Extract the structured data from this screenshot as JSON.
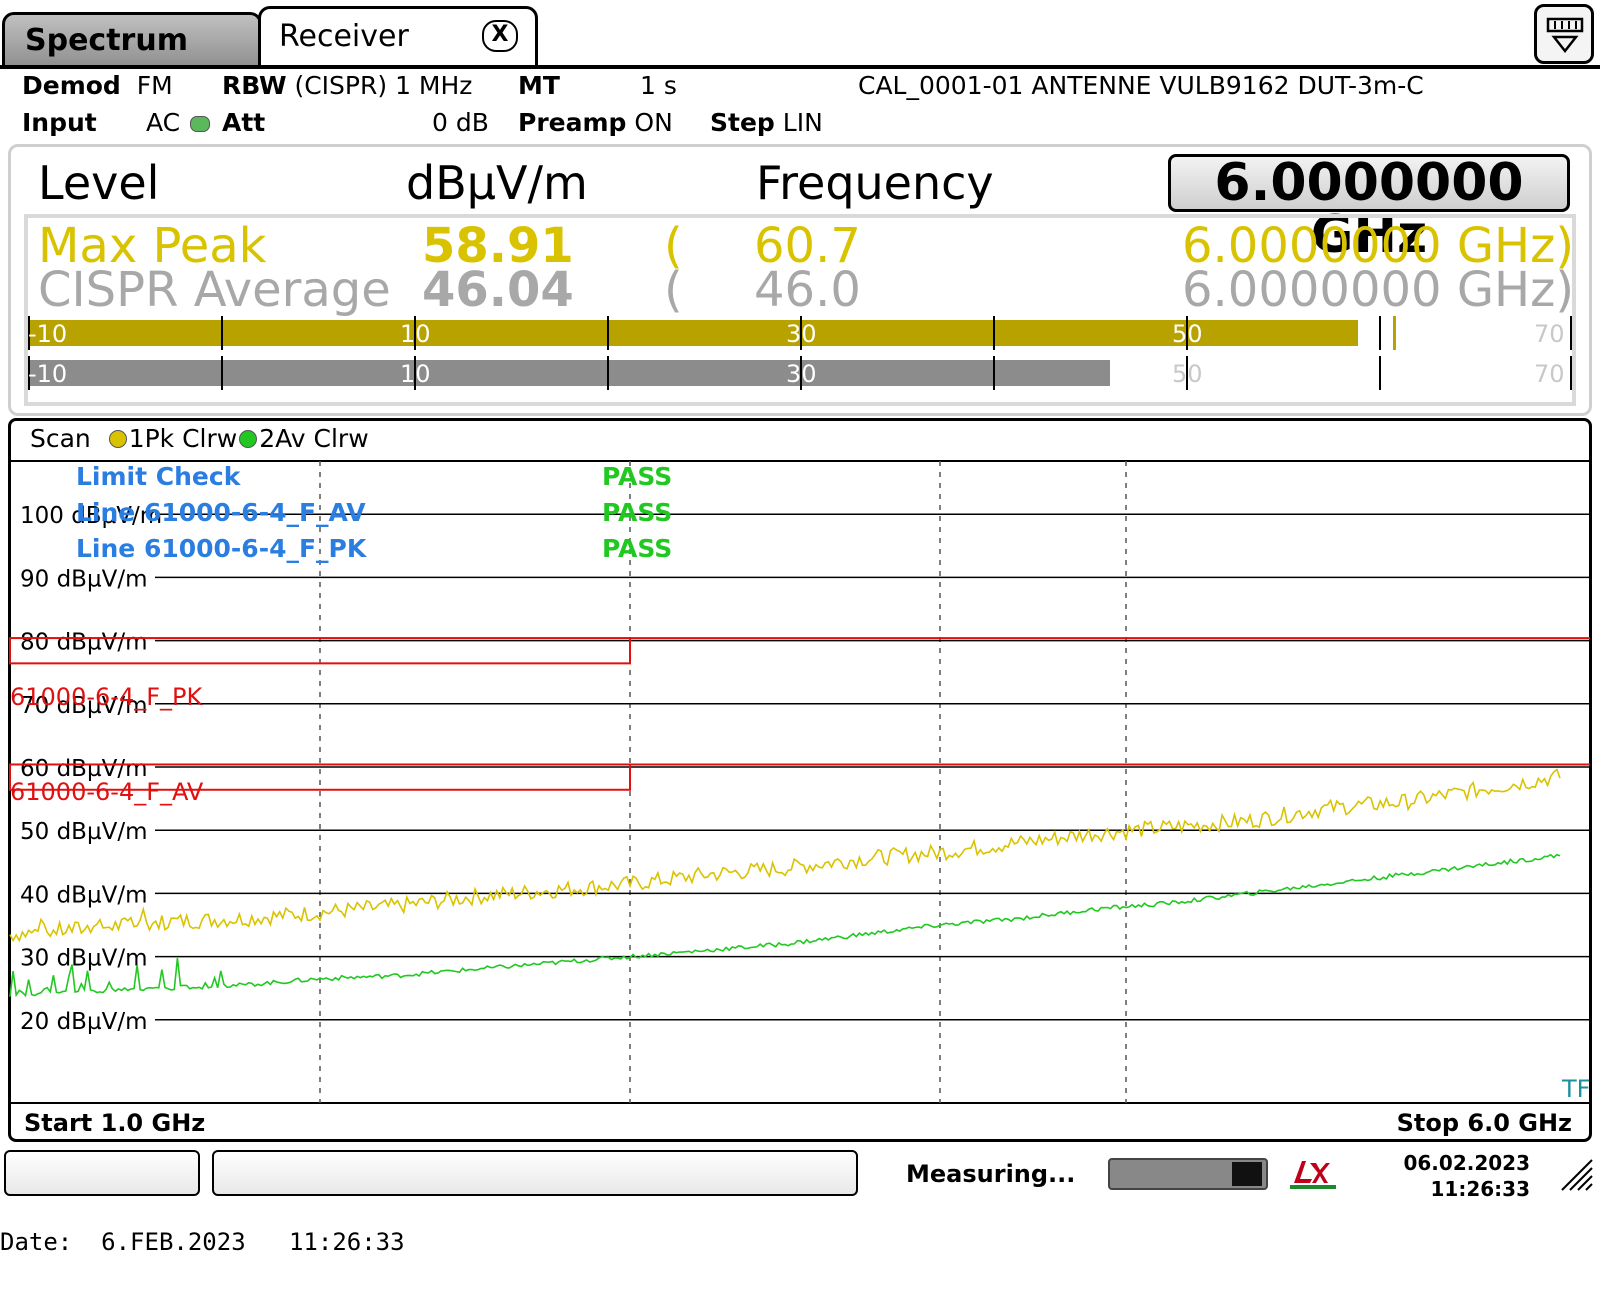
{
  "tabs": [
    {
      "label": "Spectrum",
      "active": false
    },
    {
      "label": "Receiver",
      "active": true
    }
  ],
  "tab_close_label": "X",
  "settings": {
    "demod_label": "Demod",
    "demod_value": "FM",
    "rbw_label": "RBW",
    "rbw_value": "(CISPR) 1 MHz",
    "mt_label": "MT",
    "mt_value": "1 s",
    "transducer": "CAL_0001-01 ANTENNE VULB9162 DUT-3m-C",
    "input_label": "Input",
    "input_value": "AC",
    "att_label": "Att",
    "att_value": "0 dB",
    "preamp_label": "Preamp",
    "preamp_value": "ON",
    "step_label": "Step",
    "step_value": "LIN"
  },
  "level_panel": {
    "level_label": "Level",
    "unit": "dBµV/m",
    "frequency_label": "Frequency",
    "frequency_value": "6.0000000 GHz",
    "readouts": [
      {
        "detector": "Max Peak",
        "value": "58.91",
        "paren": "(",
        "limit_value": "60.7",
        "freq": "6.0000000 GHz)",
        "color": "#d9c300"
      },
      {
        "detector": "CISPR Average",
        "value": "46.04",
        "paren": "(",
        "limit_value": "46.0",
        "freq": "6.0000000 GHz)",
        "color": "#a8a8a8"
      }
    ],
    "bar_ticks": [
      "-10",
      "10",
      "30",
      "50",
      "70"
    ],
    "bar_range": [
      -10,
      70
    ],
    "bar_peak_level": 58.91,
    "bar_peak_hold": 60.7,
    "bar_avg_level": 46.04,
    "bar_peak_color": "#b8a200",
    "bar_avg_color": "#8c8c8c"
  },
  "diagram": {
    "scan_label": "Scan",
    "trace1_label": "1Pk Clrw",
    "trace2_label": "2Av Clrw",
    "limit_check": {
      "title": "Limit Check",
      "title_result": "PASS",
      "lines": [
        {
          "name": "Line 61000-6-4_F_AV",
          "result": "PASS"
        },
        {
          "name": "Line 61000-6-4_F_PK",
          "result": "PASS"
        }
      ]
    },
    "tf_label": "TF",
    "start_label": "Start 1.0 GHz",
    "stop_label": "Stop 6.0 GHz"
  },
  "status": {
    "text": "Measuring...",
    "date": "06.02.2023",
    "time": "11:26:33"
  },
  "footer": "Date:  6.FEB.2023   11:26:33",
  "chart_data": {
    "type": "line",
    "title": "",
    "xlabel": "",
    "ylabel": "dBµV/m",
    "xlim": [
      1.0,
      6.0
    ],
    "ylim": [
      10,
      110
    ],
    "y_ticks": [
      {
        "value": 100,
        "label": "100 dBµV/m"
      },
      {
        "value": 90,
        "label": "90 dBµV/m"
      },
      {
        "value": 80,
        "label": "80 dBµV/m"
      },
      {
        "value": 70,
        "label": "70 dBµV/m"
      },
      {
        "value": 60,
        "label": "60 dBµV/m"
      },
      {
        "value": 50,
        "label": "50 dBµV/m"
      },
      {
        "value": 40,
        "label": "40 dBµV/m"
      },
      {
        "value": 30,
        "label": "30 dBµV/m"
      },
      {
        "value": 20,
        "label": "20 dBµV/m"
      }
    ],
    "grid": true,
    "limit_lines": [
      {
        "name": "61000-6-4_F_PK",
        "color": "#e01010",
        "x": [
          1.0,
          3.0,
          3.0,
          6.0
        ],
        "y": [
          76.4,
          76.4,
          80.4,
          80.4
        ]
      },
      {
        "name": "61000-6-4_F_AV",
        "color": "#e01010",
        "x": [
          1.0,
          3.0,
          3.0,
          6.0
        ],
        "y": [
          56.4,
          56.4,
          60.4,
          60.4
        ]
      }
    ],
    "series": [
      {
        "name": "1Pk Clrw",
        "color": "#d9c300",
        "x": [
          1.0,
          1.25,
          1.5,
          1.75,
          2.0,
          2.25,
          2.5,
          2.75,
          3.0,
          3.25,
          3.5,
          3.75,
          4.0,
          4.25,
          4.5,
          4.75,
          5.0,
          5.25,
          5.5,
          5.75,
          6.0
        ],
        "y": [
          33.5,
          34.5,
          35.5,
          36.0,
          37.0,
          38.0,
          39.5,
          40.5,
          41.5,
          43.0,
          44.0,
          45.5,
          46.5,
          48.0,
          49.5,
          50.5,
          51.5,
          53.5,
          54.5,
          56.5,
          58.5
        ]
      },
      {
        "name": "2Av Clrw",
        "color": "#22c822",
        "x": [
          1.0,
          1.25,
          1.5,
          1.75,
          2.0,
          2.25,
          2.5,
          2.75,
          3.0,
          3.25,
          3.5,
          3.75,
          4.0,
          4.25,
          4.5,
          4.75,
          5.0,
          5.25,
          5.5,
          5.75,
          6.0
        ],
        "y": [
          24.0,
          24.5,
          25.0,
          25.5,
          26.5,
          27.0,
          28.0,
          29.0,
          30.0,
          31.0,
          32.0,
          33.5,
          35.0,
          36.0,
          37.5,
          38.5,
          40.0,
          41.5,
          43.0,
          44.5,
          46.0
        ]
      }
    ]
  }
}
